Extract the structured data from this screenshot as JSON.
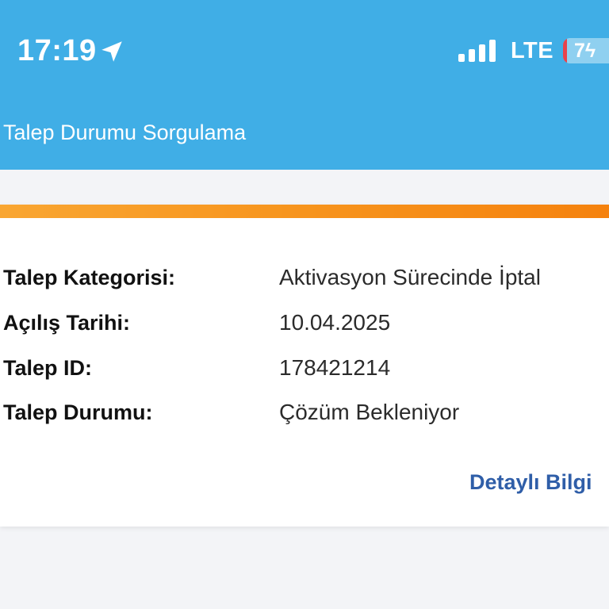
{
  "status_bar": {
    "time": "17:19",
    "network": "LTE",
    "battery_level": "7",
    "icons": [
      "location-arrow-icon",
      "signal-bars-icon",
      "battery-charging-icon"
    ]
  },
  "header": {
    "title": "Talep Durumu Sorgulama"
  },
  "colors": {
    "header_background": "#40aee6",
    "accent_gradient_start": "#f9a632",
    "accent_gradient_end": "#f5820e",
    "link": "#2f5ea8"
  },
  "request": {
    "rows": [
      {
        "label": "Talep Kategorisi:",
        "value": "Aktivasyon Sürecinde İptal"
      },
      {
        "label": "Açılış Tarihi:",
        "value": "10.04.2025"
      },
      {
        "label": "Talep ID:",
        "value": "178421214"
      },
      {
        "label": "Talep Durumu:",
        "value": "Çözüm Bekleniyor"
      }
    ],
    "details_link": "Detaylı Bilgi"
  }
}
